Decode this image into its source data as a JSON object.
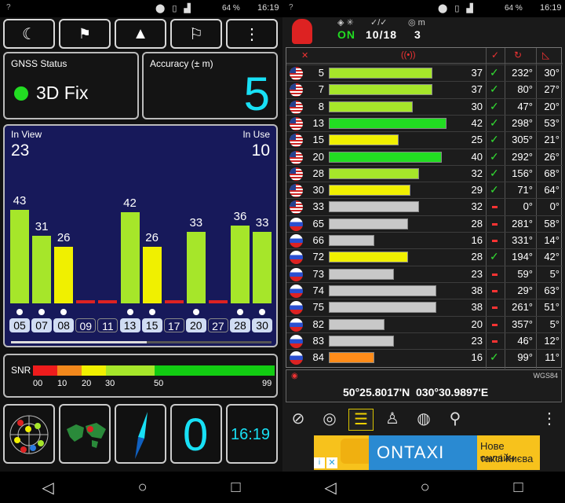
{
  "status": {
    "left_icon": "?",
    "battery": "64 %",
    "time": "16:19"
  },
  "left": {
    "toolbar": [
      "moon-icon",
      "people-icon",
      "arrow-up-icon",
      "flags-icon",
      "more-icon"
    ],
    "gnss": {
      "title": "GNSS Status",
      "fix": "3D Fix"
    },
    "accuracy": {
      "title": "Accuracy (± m)",
      "value": "5"
    },
    "sky": {
      "in_view_label": "In View",
      "in_view": "23",
      "in_use_label": "In Use",
      "in_use": "10"
    },
    "chart_data": {
      "type": "bar",
      "categories": [
        "05",
        "07",
        "08",
        "09",
        "11",
        "13",
        "15",
        "17",
        "20",
        "27",
        "28",
        "30"
      ],
      "values": [
        43,
        31,
        26,
        0,
        0,
        42,
        26,
        0,
        33,
        0,
        36,
        33
      ],
      "labels": [
        "43",
        "31",
        "26",
        "",
        "",
        "42",
        "26",
        "",
        "33",
        "",
        "36",
        "33"
      ],
      "colors": [
        "#a6e62a",
        "#a6e62a",
        "#f0f000",
        "#dd2222",
        "#dd2222",
        "#a6e62a",
        "#f0f000",
        "#dd2222",
        "#a6e62a",
        "#dd2222",
        "#a6e62a",
        "#a6e62a"
      ],
      "highlighted": [
        "05",
        "07",
        "08",
        "13",
        "15",
        "20",
        "28",
        "30"
      ],
      "ylim": [
        0,
        50
      ]
    },
    "snr": {
      "title": "SNR",
      "ticks": [
        "00",
        "10",
        "20",
        "30",
        "50",
        "99"
      ]
    },
    "tiles": {
      "zero": "0",
      "clock": "16:19"
    }
  },
  "right": {
    "status_on": "ON",
    "used_count": "10/18",
    "meter": "3",
    "coords": "50°25.8017'N  030°30.9897'E",
    "datum": "WGS84",
    "colors": {
      "green": "#22dd22",
      "lime": "#a6e62a",
      "yellow": "#f0f000",
      "gray": "#c8c8c8",
      "orange": "#ff8c1a"
    },
    "rows": [
      {
        "flag": "us",
        "prn": "5",
        "snr": "37",
        "used": true,
        "az": "232°",
        "el": "30°",
        "color": "lime",
        "strength": 0.8
      },
      {
        "flag": "us",
        "prn": "7",
        "snr": "37",
        "used": true,
        "az": "80°",
        "el": "27°",
        "color": "lime",
        "strength": 0.8
      },
      {
        "flag": "us",
        "prn": "8",
        "snr": "30",
        "used": true,
        "az": "47°",
        "el": "20°",
        "color": "lime",
        "strength": 0.65
      },
      {
        "flag": "us",
        "prn": "13",
        "snr": "42",
        "used": true,
        "az": "298°",
        "el": "53°",
        "color": "green",
        "strength": 0.91
      },
      {
        "flag": "us",
        "prn": "15",
        "snr": "25",
        "used": true,
        "az": "305°",
        "el": "21°",
        "color": "yellow",
        "strength": 0.54
      },
      {
        "flag": "us",
        "prn": "20",
        "snr": "40",
        "used": true,
        "az": "292°",
        "el": "26°",
        "color": "green",
        "strength": 0.87
      },
      {
        "flag": "us",
        "prn": "28",
        "snr": "32",
        "used": true,
        "az": "156°",
        "el": "68°",
        "color": "lime",
        "strength": 0.7
      },
      {
        "flag": "us",
        "prn": "30",
        "snr": "29",
        "used": true,
        "az": "71°",
        "el": "64°",
        "color": "yellow",
        "strength": 0.63
      },
      {
        "flag": "us",
        "prn": "33",
        "snr": "32",
        "used": false,
        "az": "0°",
        "el": "0°",
        "color": "gray",
        "strength": 0.7
      },
      {
        "flag": "ru",
        "prn": "65",
        "snr": "28",
        "used": false,
        "az": "281°",
        "el": "58°",
        "color": "gray",
        "strength": 0.61
      },
      {
        "flag": "ru",
        "prn": "66",
        "snr": "16",
        "used": false,
        "az": "331°",
        "el": "14°",
        "color": "gray",
        "strength": 0.35
      },
      {
        "flag": "ru",
        "prn": "72",
        "snr": "28",
        "used": true,
        "az": "194°",
        "el": "42°",
        "color": "yellow",
        "strength": 0.61
      },
      {
        "flag": "ru",
        "prn": "73",
        "snr": "23",
        "used": false,
        "az": "59°",
        "el": "5°",
        "color": "gray",
        "strength": 0.5
      },
      {
        "flag": "ru",
        "prn": "74",
        "snr": "38",
        "used": false,
        "az": "29°",
        "el": "63°",
        "color": "gray",
        "strength": 0.83
      },
      {
        "flag": "ru",
        "prn": "75",
        "snr": "38",
        "used": false,
        "az": "261°",
        "el": "51°",
        "color": "gray",
        "strength": 0.83
      },
      {
        "flag": "ru",
        "prn": "82",
        "snr": "20",
        "used": false,
        "az": "357°",
        "el": "5°",
        "color": "gray",
        "strength": 0.43
      },
      {
        "flag": "ru",
        "prn": "83",
        "snr": "23",
        "used": false,
        "az": "46°",
        "el": "12°",
        "color": "gray",
        "strength": 0.5
      },
      {
        "flag": "ru",
        "prn": "84",
        "snr": "16",
        "used": true,
        "az": "99°",
        "el": "11°",
        "color": "orange",
        "strength": 0.35
      }
    ],
    "ad": {
      "brand": "ONTAXI",
      "line1": "Нове онлайн",
      "line2": "таксі Києва"
    }
  }
}
